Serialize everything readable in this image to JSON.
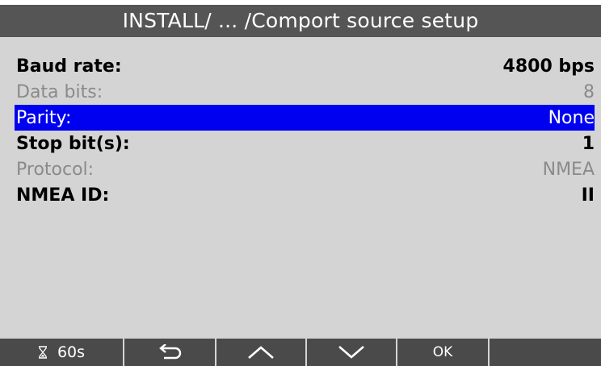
{
  "title": "INSTALL/ ... /Comport source setup",
  "rows": [
    {
      "label": "Baud rate:",
      "value": "4800 bps",
      "state": "enabled"
    },
    {
      "label": "Data bits:",
      "value": "8",
      "state": "disabled"
    },
    {
      "label": "Parity:",
      "value": "None",
      "state": "selected"
    },
    {
      "label": "Stop bit(s):",
      "value": "1",
      "state": "enabled"
    },
    {
      "label": "Protocol:",
      "value": "NMEA",
      "state": "disabled"
    },
    {
      "label": "NMEA ID:",
      "value": "II",
      "state": "enabled"
    }
  ],
  "toolbar": {
    "timer_label": "60s",
    "timer_icon": "hourglass-icon",
    "back_icon": "back-arrow-icon",
    "up_icon": "chevron-up-icon",
    "down_icon": "chevron-down-icon",
    "ok_label": "OK"
  },
  "colors": {
    "title_bg": "#555555",
    "body_bg": "#d4d4d4",
    "selected_bg": "#0000f0",
    "disabled_text": "#8a8a8a",
    "toolbar_bg": "#4a4a4a"
  }
}
